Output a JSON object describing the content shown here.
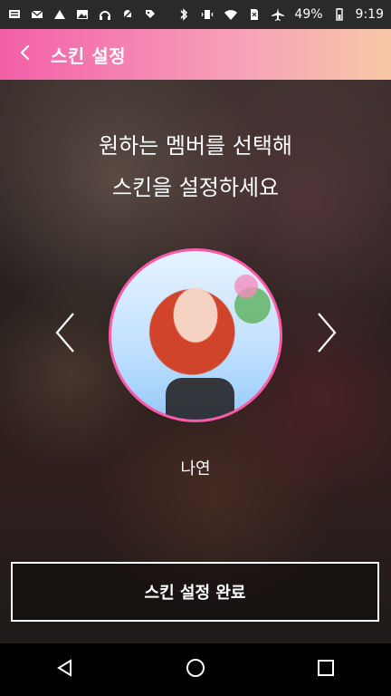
{
  "status_bar": {
    "battery_percent": "49%",
    "time": "9:19",
    "icons_left": [
      "chat-icon",
      "mail-icon",
      "app-icon",
      "image-icon",
      "headset-icon",
      "bell-off-icon",
      "tag-icon"
    ],
    "icons_right": [
      "bluetooth-icon",
      "vibrate-icon",
      "wifi-icon",
      "sim-icon",
      "airplane-icon",
      "battery-icon"
    ]
  },
  "app_bar": {
    "title": "스킨 설정",
    "back_icon": "chevron-left-icon"
  },
  "main": {
    "headline_line1": "원하는 멤버를 선택해",
    "headline_line2": "스킨을 설정하세요",
    "member_name": "나연",
    "prev_icon": "chevron-left-icon",
    "next_icon": "chevron-right-icon",
    "confirm_label": "스킨 설정 완료"
  },
  "nav_bar": {
    "back": "back-triangle-icon",
    "home": "home-circle-icon",
    "recents": "recents-square-icon"
  },
  "colors": {
    "appbar_gradient_start": "#f35fa8",
    "appbar_gradient_end": "#f7c8a6",
    "avatar_border": "#ff5aa8"
  }
}
